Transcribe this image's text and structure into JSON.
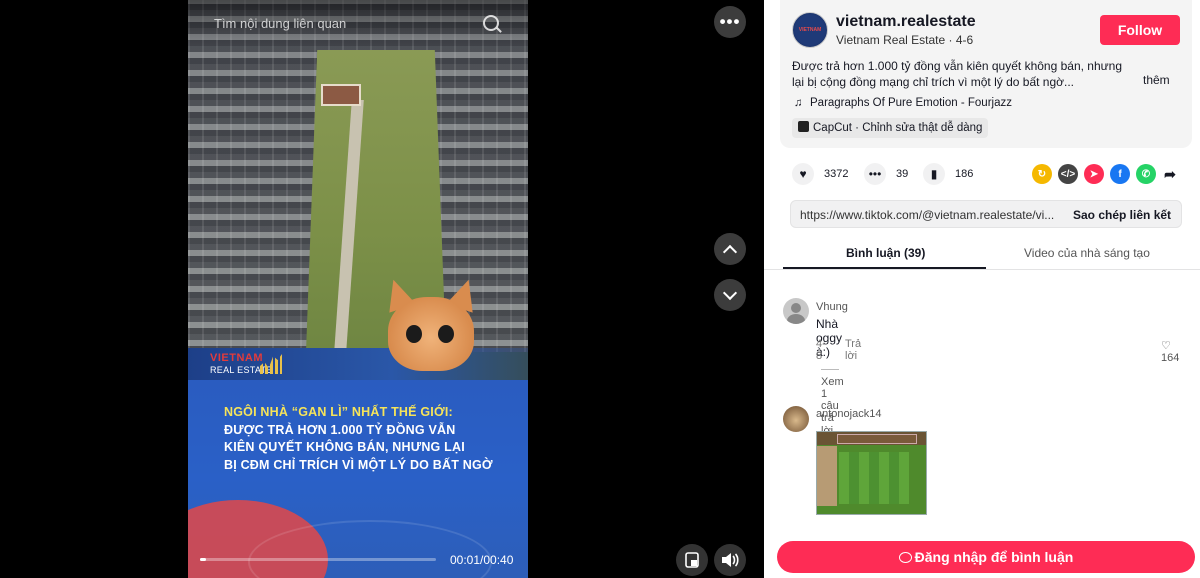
{
  "video": {
    "search_placeholder": "Tìm nội dung liên quan",
    "brand_title": "VIETNAM",
    "brand_sub": "REAL ESTATE",
    "caption_line1": "NGÔI NHÀ “GAN LÌ” NHẤT THẾ GIỚI:",
    "caption_line2": "ĐƯỢC TRẢ HƠN 1.000 TỶ ĐỒNG VẪN",
    "caption_line3": "KIÊN QUYẾT KHÔNG BÁN, NHƯNG LẠI",
    "caption_line4": "BỊ CĐM CHỈ TRÍCH VÌ MỘT LÝ DO BẤT NGỜ",
    "time": "00:01/00:40",
    "progress_fraction": 0.025
  },
  "controls": {
    "more_label": "•••"
  },
  "author": {
    "username": "vietnam.realestate",
    "display": "Vietnam Real Estate · 4-6",
    "follow_label": "Follow",
    "description": "Được trả hơn 1.000 tỷ đồng vẫn kiên quyết không bán, nhưng lại bị cộng đồng mạng chỉ trích vì một lý do bất ngờ...",
    "more_label": "thêm",
    "music": "Paragraphs Of Pure Emotion - Fourjazz",
    "capcut": "CapCut · Chỉnh sửa thật dễ dàng"
  },
  "stats": {
    "likes": "3372",
    "comments": "39",
    "saves": "186"
  },
  "share": {
    "url": "https://www.tiktok.com/@vietnam.realestate/vi...",
    "copy_label": "Sao chép liên kết",
    "colors": [
      "#f5b800",
      "#444444",
      "#fe2c55",
      "#1877f2",
      "#25d366"
    ]
  },
  "tabs": {
    "comments": "Bình luận (39)",
    "creator_videos": "Video của nhà sáng tạo"
  },
  "comments": [
    {
      "name": "Vhung",
      "text": "Nhà oggy à:)",
      "date": "4-8",
      "reply_label": "Trả lời",
      "likes": "164",
      "view_replies": "Xem 1 câu trả lời"
    },
    {
      "name": "antonojack14"
    }
  ],
  "login_label": "Đăng nhập để bình luận"
}
